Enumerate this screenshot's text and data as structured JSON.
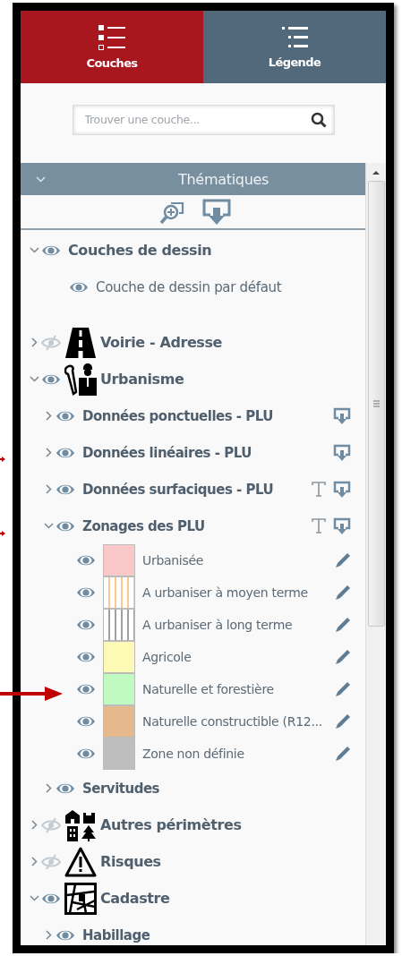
{
  "tabs": [
    {
      "label": "Couches",
      "selected": true
    },
    {
      "label": "Légende",
      "selected": false
    }
  ],
  "search": {
    "placeholder": "Trouver une couche..."
  },
  "section": {
    "title": "Thématiques",
    "expanded": true
  },
  "layers": [
    {
      "label": "Couches de dessin",
      "kind": "group",
      "expanded": true,
      "visible": true,
      "children": [
        {
          "label": "Couche de dessin par défaut",
          "kind": "layer",
          "visible": true
        }
      ]
    },
    {
      "label": "Voirie - Adresse",
      "kind": "theme",
      "expanded": false,
      "visible": false
    },
    {
      "label": "Urbanisme",
      "kind": "theme",
      "expanded": true,
      "visible": true,
      "children": [
        {
          "label": "Données ponctuelles - PLU",
          "kind": "group",
          "expanded": false,
          "visible": true,
          "labels": false,
          "export": true
        },
        {
          "label": "Données linéaires - PLU",
          "kind": "group",
          "expanded": false,
          "visible": true,
          "labels": false,
          "export": true
        },
        {
          "label": "Données surfaciques - PLU",
          "kind": "group",
          "expanded": false,
          "visible": true,
          "labels": true,
          "export": true
        },
        {
          "label": "Zonages des PLU",
          "kind": "group",
          "expanded": true,
          "visible": true,
          "labels": true,
          "export": true,
          "children": [
            {
              "label": "Urbanisée",
              "kind": "legend",
              "visible": true,
              "color": "#fac8c8",
              "hatched": false
            },
            {
              "label": "A urbaniser à moyen terme",
              "kind": "legend",
              "visible": true,
              "color": "#fcc890",
              "hatched": true
            },
            {
              "label": "A urbaniser à long terme",
              "kind": "legend",
              "visible": true,
              "color": "#a0a0a0",
              "hatched": true
            },
            {
              "label": "Agricole",
              "kind": "legend",
              "visible": true,
              "color": "#fcfab4",
              "hatched": false
            },
            {
              "label": "Naturelle et forestière",
              "kind": "legend",
              "visible": true,
              "color": "#c0fac0",
              "hatched": false
            },
            {
              "label": "Naturelle constructible (R12...",
              "kind": "legend",
              "visible": true,
              "color": "#e6b98c",
              "hatched": false
            },
            {
              "label": "Zone non définie",
              "kind": "legend",
              "visible": true,
              "color": "#bebebe",
              "hatched": false
            }
          ]
        },
        {
          "label": "Servitudes",
          "kind": "group",
          "expanded": false,
          "visible": true,
          "labels": false,
          "export": false
        }
      ]
    },
    {
      "label": "Autres périmètres",
      "kind": "theme",
      "expanded": false,
      "visible": false
    },
    {
      "label": "Risques",
      "kind": "theme",
      "expanded": false,
      "visible": false
    },
    {
      "label": "Cadastre",
      "kind": "theme",
      "expanded": true,
      "visible": true,
      "children": [
        {
          "label": "Habillage",
          "kind": "group",
          "expanded": false,
          "visible": true
        }
      ]
    }
  ]
}
